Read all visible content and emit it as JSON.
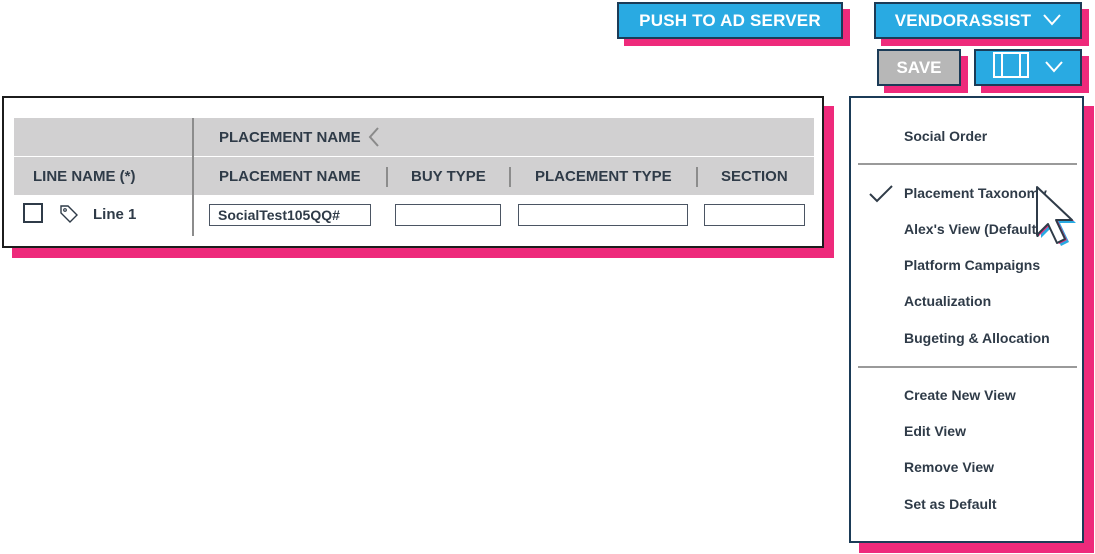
{
  "toolbar": {
    "push_label": "PUSH TO AD SERVER",
    "vendor_label": "VENDORASSIST",
    "save_label": "SAVE"
  },
  "table": {
    "group_header": "PLACEMENT NAME",
    "columns": [
      "LINE NAME (*)",
      "PLACEMENT NAME",
      "BUY TYPE",
      "PLACEMENT TYPE",
      "SECTION"
    ],
    "rows": [
      {
        "line_name": "Line 1",
        "placement_name": "SocialTest105QQ#",
        "buy_type": "",
        "placement_type": "",
        "section": ""
      }
    ]
  },
  "dropdown": {
    "header_item": "Social Order",
    "views": [
      {
        "label": "Placement Taxonomy",
        "checked": true
      },
      {
        "label": "Alex's View (Default)",
        "checked": false
      },
      {
        "label": "Platform Campaigns",
        "checked": false
      },
      {
        "label": "Actualization",
        "checked": false
      },
      {
        "label": "Bugeting & Allocation",
        "checked": false
      }
    ],
    "actions": [
      "Create New View",
      "Edit View",
      "Remove View",
      "Set as Default"
    ]
  },
  "colors": {
    "accent": "#29aae2",
    "shadow": "#ee2a7b",
    "header_bg": "#d1d0d1",
    "text": "#2f3b48"
  },
  "icons": [
    "chevron-down-icon",
    "columns-icon",
    "tag-icon",
    "checkmark-icon",
    "cursor-icon",
    "chevron-left-icon"
  ]
}
